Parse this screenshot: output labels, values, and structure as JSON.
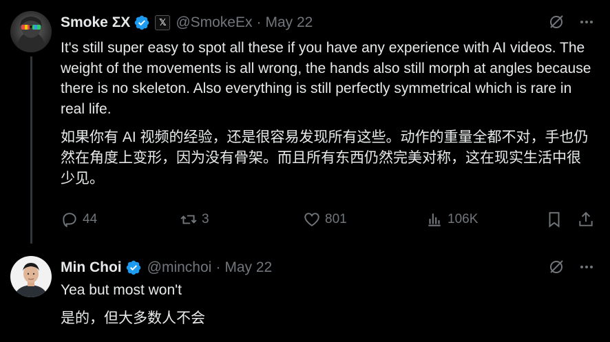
{
  "tweets": [
    {
      "name": "Smoke ΣΧ",
      "handle": "@SmokeEx",
      "separator": "·",
      "date": "May 22",
      "badge_x": "𝕏",
      "text_en": "It's still super easy to spot all these if you have any experience with AI videos. The weight of the movements is all wrong, the hands also still morph at angles because there is no skeleton. Also everything is still perfectly symmetrical which is rare in real life.",
      "text_zh": "如果你有 AI 视频的经验，还是很容易发现所有这些。动作的重量全都不对，手也仍然在角度上变形，因为没有骨架。而且所有东西仍然完美对称，这在现实生活中很少见。",
      "stats": {
        "replies": "44",
        "retweets": "3",
        "likes": "801",
        "views": "106K"
      }
    },
    {
      "name": "Min Choi",
      "handle": "@minchoi",
      "separator": "·",
      "date": "May 22",
      "text_en": "Yea but most won't",
      "text_zh": "是的，但大多数人不会"
    }
  ],
  "colors": {
    "background": "#000000",
    "text": "#e7e9ea",
    "muted": "#71767b",
    "verified": "#1d9bf0",
    "thread_line": "#333639"
  },
  "icons": [
    "verified-badge-icon",
    "x-affiliate-icon",
    "grok-icon",
    "more-icon",
    "reply-icon",
    "retweet-icon",
    "like-icon",
    "views-icon",
    "bookmark-icon",
    "share-icon"
  ]
}
